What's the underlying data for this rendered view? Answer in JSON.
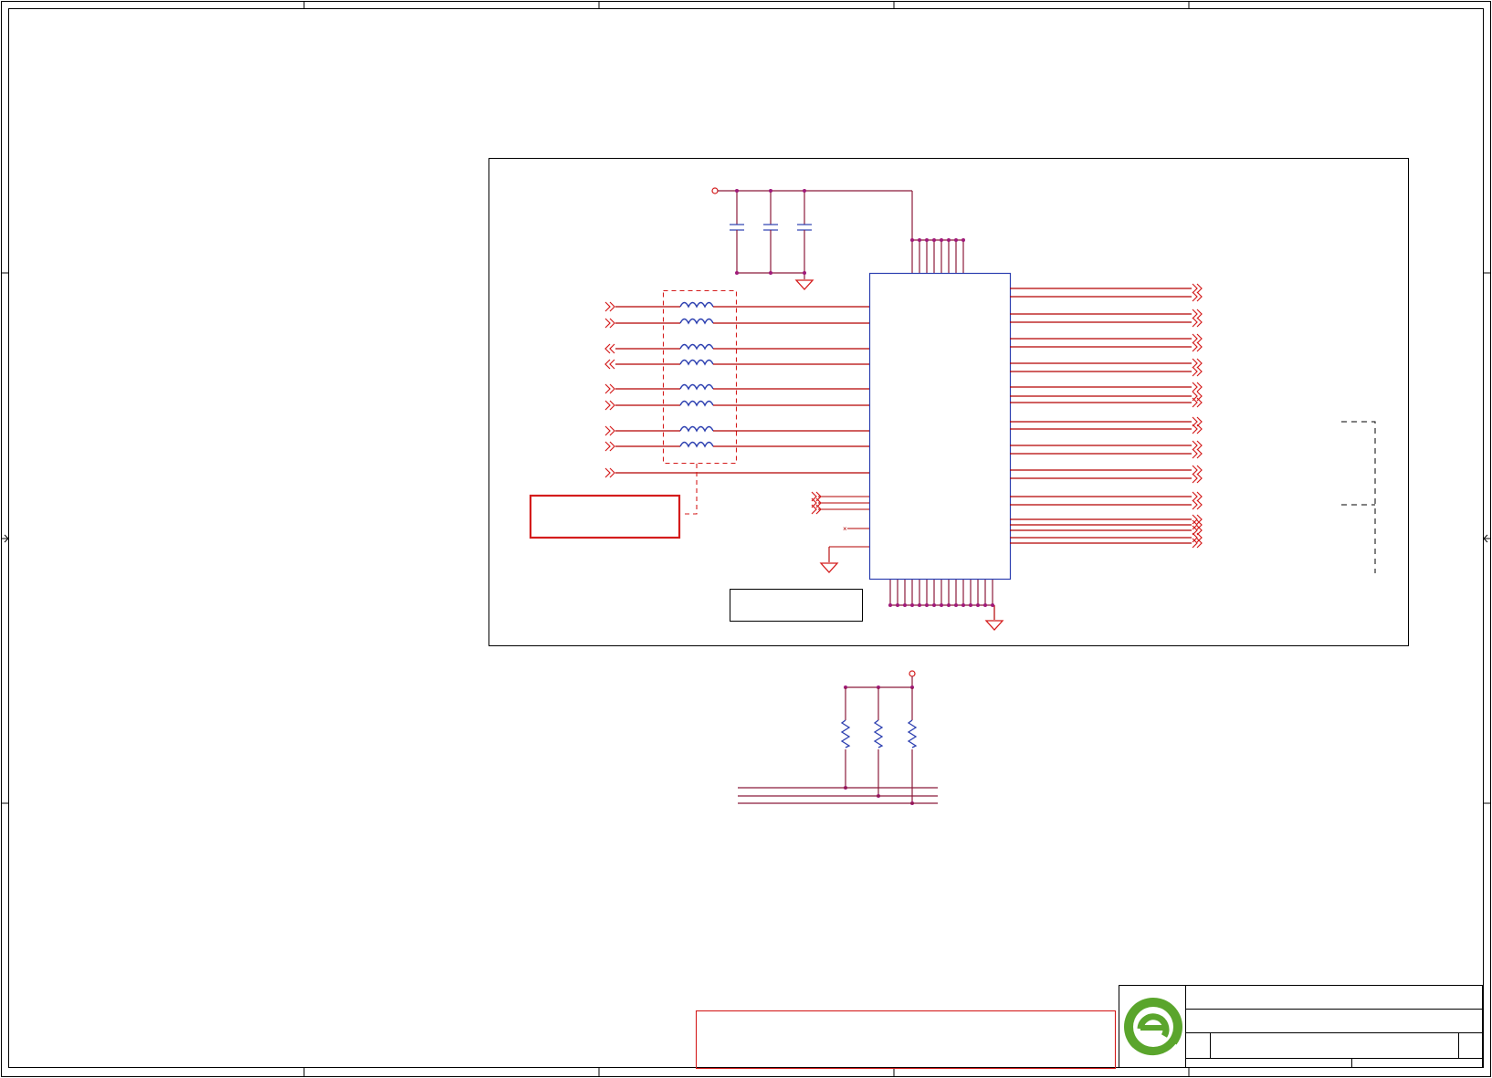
{
  "sheet": {
    "grid_columns": [
      "",
      "",
      "",
      "",
      ""
    ],
    "grid_rows": [
      "",
      "",
      "",
      ""
    ]
  },
  "schematic": {
    "main_component": {
      "ref": "",
      "value": ""
    },
    "inductor_array": {
      "count": 8
    },
    "decoupling_caps": {
      "count": 3
    },
    "pullup_resistors": {
      "count": 3
    },
    "left_inputs": {
      "count": 9,
      "directions": [
        "in",
        "in",
        "out",
        "out",
        "in",
        "in",
        "in",
        "in",
        "in"
      ]
    },
    "right_outputs": {
      "count": 24
    },
    "note_box": {
      "text": ""
    },
    "label_box": {
      "text": ""
    }
  },
  "title_block": {
    "logo": "green-e-logo",
    "title": "",
    "document_number": "",
    "revision": "",
    "sheet": "",
    "date": ""
  },
  "disclaimer": {
    "text": ""
  },
  "colors": {
    "frame": "#000000",
    "wire": "#b30000",
    "net": "#8b1a3a",
    "component": "#2c3fb0",
    "note_border": "#d41c1c",
    "junction": "#a01a7a",
    "logo_green": "#5aa52c"
  }
}
